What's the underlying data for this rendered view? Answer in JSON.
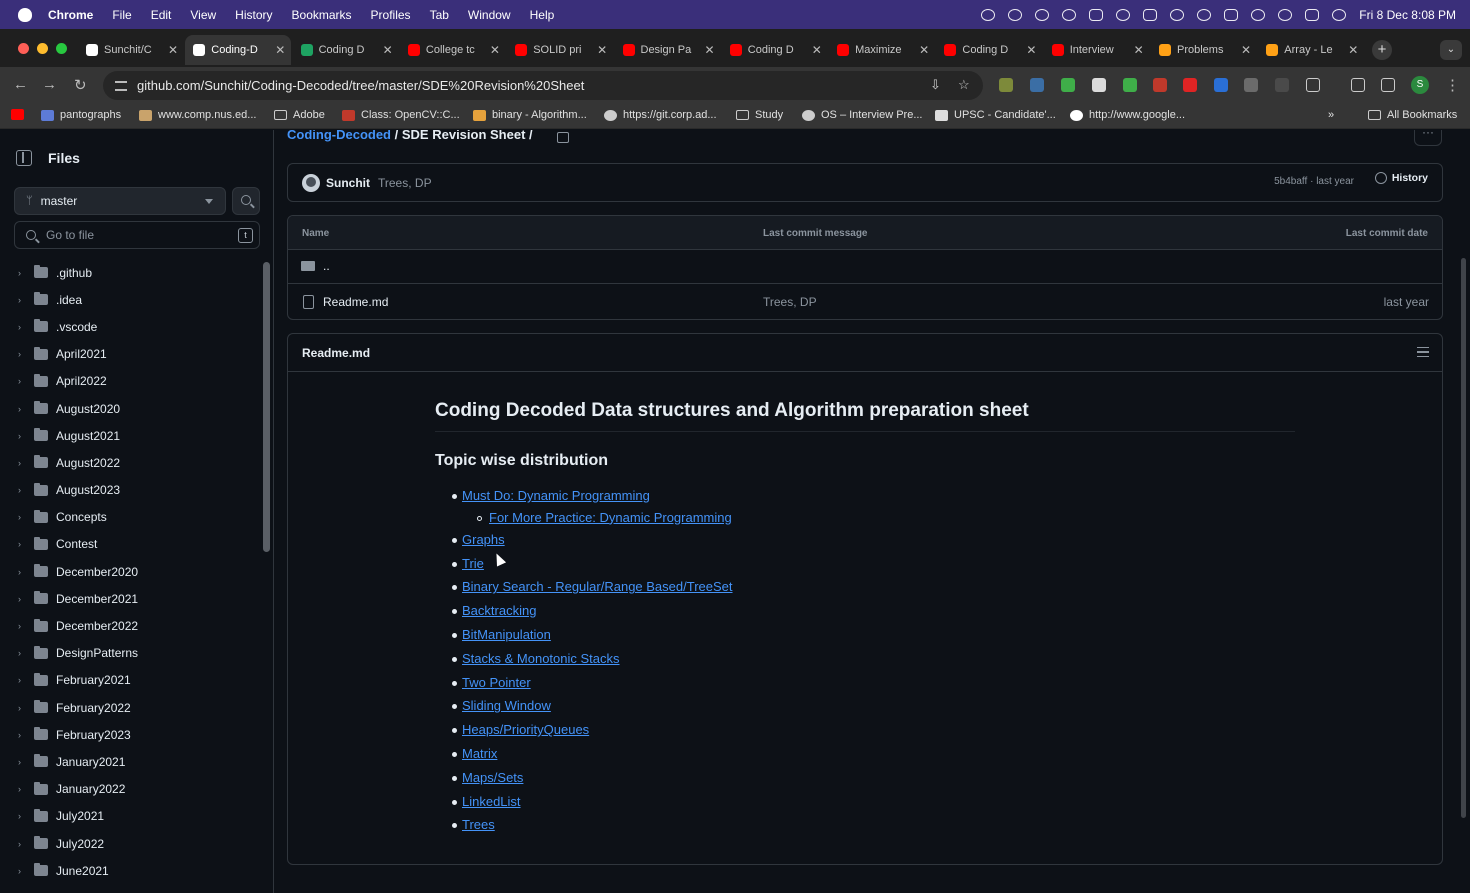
{
  "menubar": {
    "app": "Chrome",
    "items": [
      "File",
      "Edit",
      "View",
      "History",
      "Bookmarks",
      "Profiles",
      "Tab",
      "Window",
      "Help"
    ],
    "clock": "Fri 8 Dec  8:08 PM"
  },
  "tabs": [
    {
      "label": "Sunchit/C",
      "color": "#ffffff",
      "active": false
    },
    {
      "label": "Coding-D",
      "color": "#ffffff",
      "active": true
    },
    {
      "label": "Coding D",
      "color": "#1ea362",
      "active": false
    },
    {
      "label": "College tc",
      "color": "#ff0000",
      "active": false
    },
    {
      "label": "SOLID pri",
      "color": "#ff0000",
      "active": false
    },
    {
      "label": "Design Pa",
      "color": "#ff0000",
      "active": false
    },
    {
      "label": "Coding D",
      "color": "#ff0000",
      "active": false
    },
    {
      "label": "Maximize",
      "color": "#ff0000",
      "active": false
    },
    {
      "label": "Coding D",
      "color": "#ff0000",
      "active": false
    },
    {
      "label": "Interview",
      "color": "#ff0000",
      "active": false
    },
    {
      "label": "Problems",
      "color": "#ffa116",
      "active": false
    },
    {
      "label": "Array - Le",
      "color": "#ffa116",
      "active": false
    }
  ],
  "address_bar": {
    "url": "github.com/Sunchit/Coding-Decoded/tree/master/SDE%20Revision%20Sheet"
  },
  "bookmarks": [
    {
      "label": "pantographs",
      "kind": "site"
    },
    {
      "label": "www.comp.nus.ed...",
      "kind": "site"
    },
    {
      "label": "Adobe",
      "kind": "folder"
    },
    {
      "label": "Class: OpenCV::C...",
      "kind": "site"
    },
    {
      "label": "binary - Algorithm...",
      "kind": "site"
    },
    {
      "label": "https://git.corp.ad...",
      "kind": "site"
    },
    {
      "label": "Study",
      "kind": "folder"
    },
    {
      "label": "OS – Interview Pre...",
      "kind": "site"
    },
    {
      "label": "UPSC - Candidate'...",
      "kind": "site"
    },
    {
      "label": "http://www.google...",
      "kind": "site"
    },
    {
      "label": "All Bookmarks",
      "kind": "folder"
    }
  ],
  "sidebar": {
    "title": "Files",
    "branch": "master",
    "go_to_file": "Go to file",
    "shortcut": "t",
    "tree": [
      ".github",
      ".idea",
      ".vscode",
      "April2021",
      "April2022",
      "August2020",
      "August2021",
      "August2022",
      "August2023",
      "Concepts",
      "Contest",
      "December2020",
      "December2021",
      "December2022",
      "DesignPatterns",
      "February2021",
      "February2022",
      "February2023",
      "January2021",
      "January2022",
      "July2021",
      "July2022",
      "June2021"
    ]
  },
  "breadcrumb": {
    "repo": "Coding-Decoded",
    "separator": "/",
    "folder": "SDE Revision Sheet",
    "trailing": "/"
  },
  "commit": {
    "author": "Sunchit",
    "message": "Trees, DP",
    "meta": "5b4baff · last year",
    "history_label": "History"
  },
  "file_table": {
    "headers": {
      "name": "Name",
      "message": "Last commit message",
      "date": "Last commit date"
    },
    "parent": "..",
    "rows": [
      {
        "name": "Readme.md",
        "message": "Trees, DP",
        "date": "last year"
      }
    ]
  },
  "readme": {
    "filename": "Readme.md",
    "h1": "Coding Decoded Data structures and Algorithm preparation sheet",
    "h2": "Topic wise distribution",
    "links": [
      {
        "text": "Must Do: Dynamic Programming",
        "level": 1
      },
      {
        "text": "For More Practice: Dynamic Programming",
        "level": 2
      },
      {
        "text": "Graphs",
        "level": 1
      },
      {
        "text": "Trie",
        "level": 1
      },
      {
        "text": "Binary Search - Regular/Range Based/TreeSet",
        "level": 1
      },
      {
        "text": "Backtracking",
        "level": 1
      },
      {
        "text": "BitManipulation",
        "level": 1
      },
      {
        "text": "Stacks & Monotonic Stacks",
        "level": 1
      },
      {
        "text": "Two Pointer",
        "level": 1
      },
      {
        "text": "Sliding Window",
        "level": 1
      },
      {
        "text": "Heaps/PriorityQueues",
        "level": 1
      },
      {
        "text": "Matrix",
        "level": 1
      },
      {
        "text": "Maps/Sets",
        "level": 1
      },
      {
        "text": "LinkedList",
        "level": 1
      },
      {
        "text": "Trees",
        "level": 1
      }
    ]
  },
  "colors": {
    "accent_link": "#4493f8",
    "page_bg": "#0d1117",
    "border": "#30363d"
  }
}
